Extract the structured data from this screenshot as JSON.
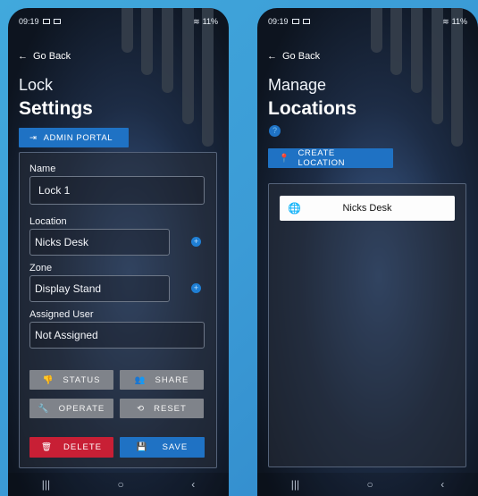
{
  "left": {
    "status": {
      "time": "09:19",
      "battery": "11%"
    },
    "back_label": "Go Back",
    "title_line1": "Lock",
    "title_line2": "Settings",
    "admin_portal_label": "ADMIN PORTAL",
    "name_label": "Name",
    "name_value": "Lock 1",
    "location_label": "Location",
    "location_value": "Nicks Desk",
    "zone_label": "Zone",
    "zone_value": "Display Stand",
    "assigned_user_label": "Assigned User",
    "assigned_user_value": "Not Assigned",
    "buttons": {
      "status": "STATUS",
      "share": "SHARE",
      "operate": "OPERATE",
      "reset": "RESET",
      "delete": "DELETE",
      "save": "SAVE"
    }
  },
  "right": {
    "status": {
      "time": "09:19",
      "battery": "11%"
    },
    "back_label": "Go Back",
    "title_line1": "Manage",
    "title_line2": "Locations",
    "help_glyph": "?",
    "create_location_label": "CREATE LOCATION",
    "locations": [
      "Nicks Desk"
    ]
  },
  "nav": {
    "recent": "|||",
    "home": "○",
    "back": "‹"
  },
  "colors": {
    "background": "#3b9bd6",
    "primary_blue": "#1f72c4",
    "delete_red": "#c81f35",
    "action_grey": "#7f838a"
  },
  "icons": {
    "back": "arrow-left-icon",
    "admin": "login-icon",
    "status": "thumbs-icon",
    "share": "users-icon",
    "operate": "wrench-icon",
    "reset": "sync-icon",
    "delete": "trash-icon",
    "save": "floppy-icon",
    "location": "pin-icon",
    "globe": "globe-icon"
  }
}
